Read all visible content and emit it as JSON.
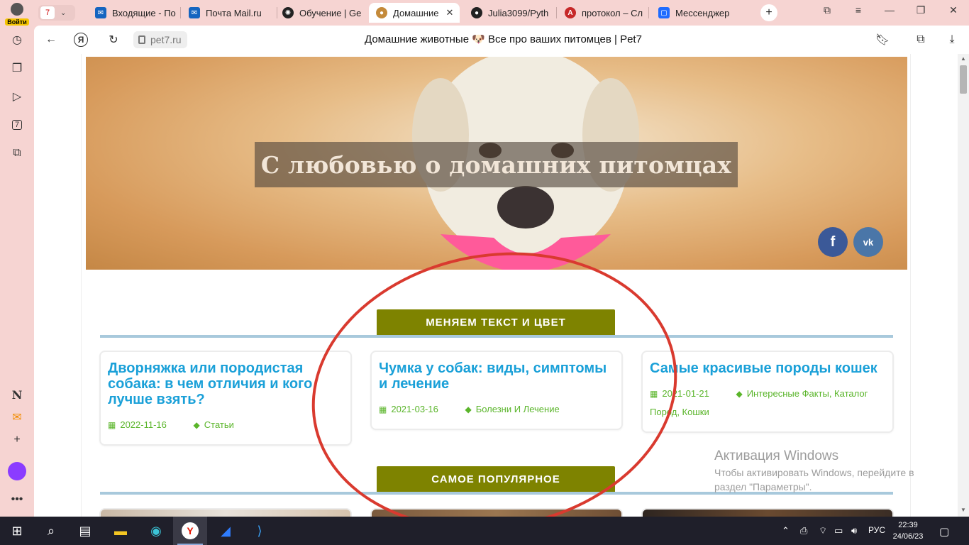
{
  "browser": {
    "login_label": "Войти",
    "tab_count": "7",
    "tabs": [
      {
        "title": "Входящие - По",
        "icon": "mail-icon",
        "color": "#1565c0"
      },
      {
        "title": "Почта Mail.ru",
        "icon": "mail-icon",
        "color": "#1565c0"
      },
      {
        "title": "Обучение | Ge",
        "icon": "openai-icon",
        "color": "#222222"
      },
      {
        "title": "Домашние",
        "icon": "pug-icon",
        "color": "#c48a3a"
      },
      {
        "title": "Julia3099/Pyth",
        "icon": "github-icon",
        "color": "#222222"
      },
      {
        "title": "протокол – Сл",
        "icon": "dictionary-icon",
        "color": "#c62828"
      },
      {
        "title": "Мессенджер",
        "icon": "messenger-icon",
        "color": "#1e6bff"
      }
    ],
    "url": "pet7.ru",
    "page_title": "Домашние животные 🐶 Все про ваших питомцев | Pet7"
  },
  "hero": {
    "title": "С любовью о домашних питомцах",
    "social": [
      "f",
      "vk"
    ]
  },
  "sections": [
    {
      "label": "МЕНЯЕМ ТЕКСТ И ЦВЕТ"
    },
    {
      "label": "САМОЕ ПОПУЛЯРНОЕ"
    }
  ],
  "cards": [
    {
      "title": "Дворняжка или породистая собака: в чем отличия и кого лучше взять?",
      "date": "2022-11-16",
      "tags": "Статьи"
    },
    {
      "title": "Чумка у собак: виды, симптомы и лечение",
      "date": "2021-03-16",
      "tags": "Болезни И Лечение"
    },
    {
      "title": "Самые красивые породы кошек",
      "date": "2021-01-21",
      "tags": "Интересные Факты, Каталог Пород, Кошки"
    }
  ],
  "watermark": {
    "title": "Активация Windows",
    "text": "Чтобы активировать Windows, перейдите в раздел \"Параметры\"."
  },
  "taskbar": {
    "lang": "РУС",
    "time": "22:39",
    "date": "24/06/23"
  },
  "colors": {
    "accent_link": "#1aa0d8",
    "meta_green": "#5ab52a",
    "section_olive": "#7e8300",
    "annotation_red": "#d93a2f"
  }
}
